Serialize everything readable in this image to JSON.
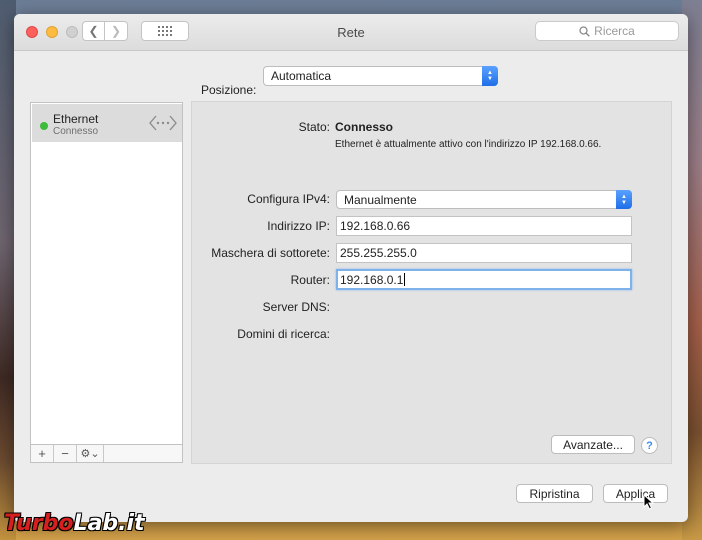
{
  "window": {
    "title": "Rete"
  },
  "toolbar": {
    "search_placeholder": "Ricerca"
  },
  "location": {
    "label": "Posizione:",
    "value": "Automatica"
  },
  "services": [
    {
      "name": "Ethernet",
      "status": "Connesso",
      "status_color": "#3ebb3b"
    }
  ],
  "sidebar_tools": {
    "add": "+",
    "remove": "−",
    "action": "⚙︎⌄"
  },
  "detail": {
    "status_label": "Stato:",
    "status_value": "Connesso",
    "status_description": "Ethernet è attualmente attivo con l'indirizzo IP 192.168.0.66.",
    "configure_ipv4": {
      "label": "Configura IPv4:",
      "value": "Manualmente"
    },
    "ip_address": {
      "label": "Indirizzo IP:",
      "value": "192.168.0.66"
    },
    "subnet_mask": {
      "label": "Maschera di sottorete:",
      "value": "255.255.255.0"
    },
    "router": {
      "label": "Router:",
      "value": "192.168.0.1"
    },
    "dns_server": {
      "label": "Server DNS:"
    },
    "search_domains": {
      "label": "Domini di ricerca:"
    },
    "advanced_button": "Avanzate...",
    "help_button": "?"
  },
  "footer": {
    "revert_button": "Ripristina",
    "apply_button": "Applica"
  },
  "watermark": {
    "part1": "Turbo",
    "part2": "Lab.it"
  },
  "colors": {
    "accent": "#1f6ee8",
    "focus_ring": "#7fb1ea"
  }
}
